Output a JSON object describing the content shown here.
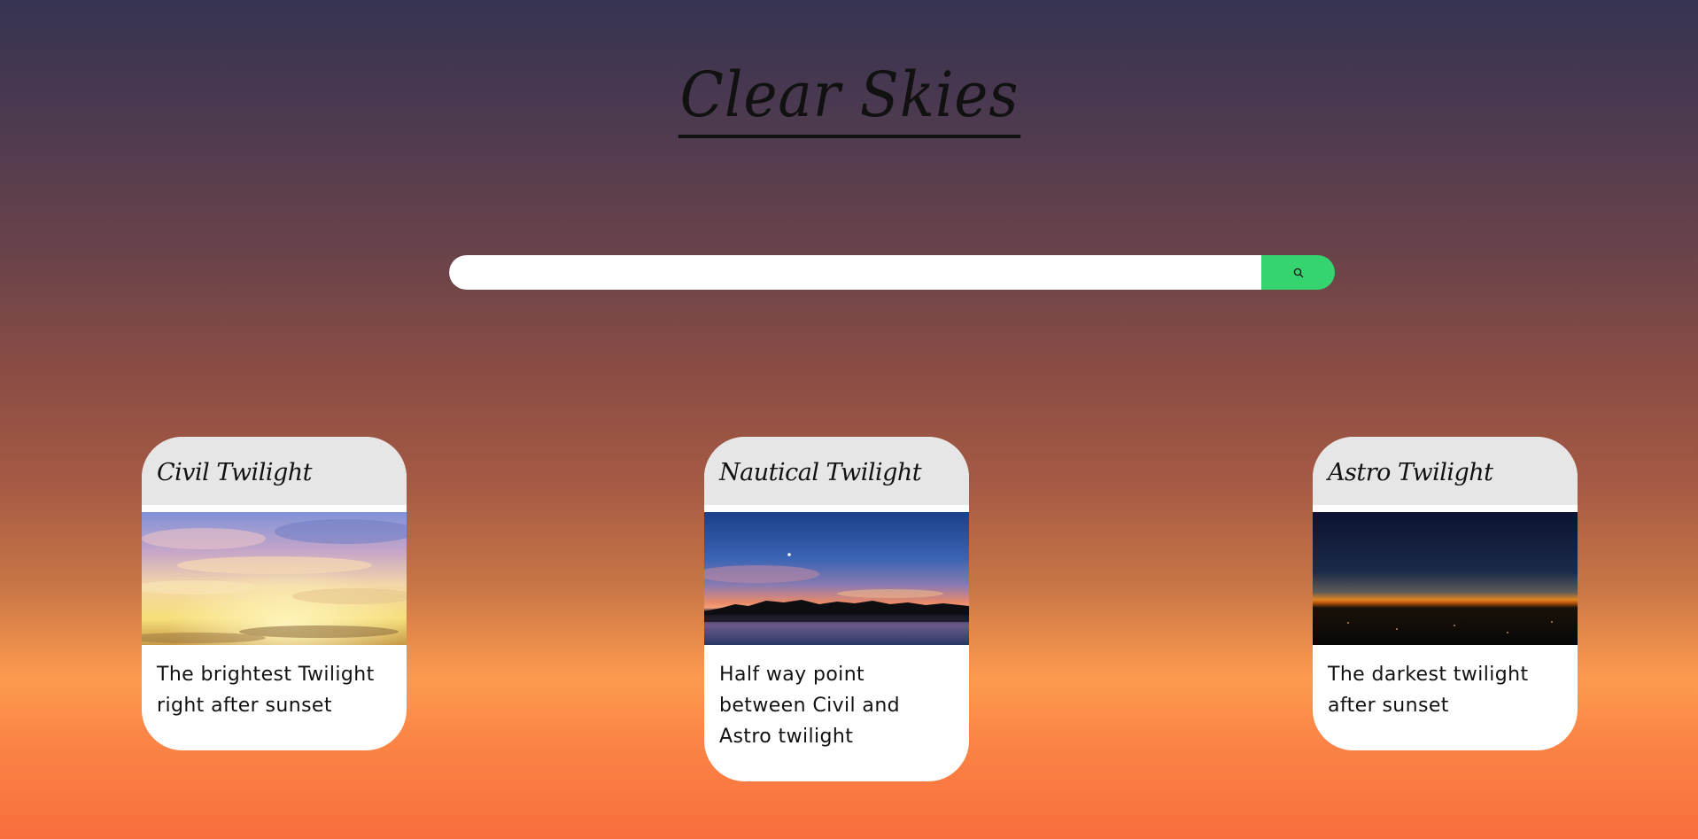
{
  "header": {
    "title": "Clear Skies"
  },
  "search": {
    "placeholder": "",
    "value": "",
    "button_icon": "search-icon",
    "button_color": "#35d46f"
  },
  "cards": [
    {
      "title": "Civil Twilight",
      "image_alt": "bright sunset sky with clouds",
      "description": "The brightest Twilight right after sunset"
    },
    {
      "title": "Nautical Twilight",
      "image_alt": "dusk sky over lake with tree silhouette",
      "description": "Half way point between Civil and Astro twilight"
    },
    {
      "title": "Astro Twilight",
      "image_alt": "dark night sky with orange horizon",
      "description": "The darkest twilight after sunset"
    }
  ]
}
